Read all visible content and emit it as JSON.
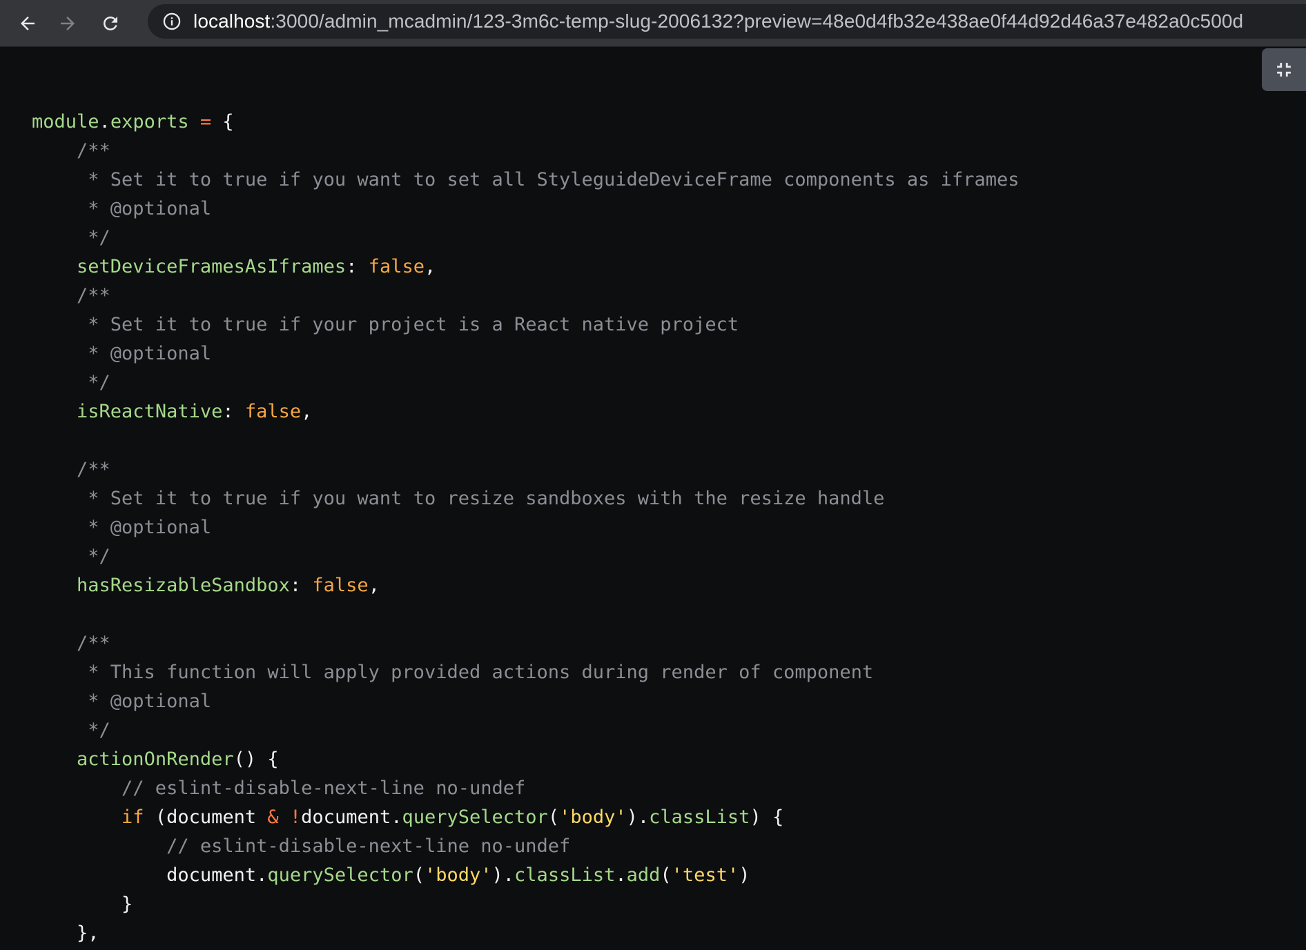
{
  "browser": {
    "url_host": "localhost",
    "url_rest": ":3000/admin_mcadmin/123-3m6c-temp-slug-2006132?preview=48e0d4fb32e438ae0f44d92d46a37e482a0c500d"
  },
  "code": {
    "l1": {
      "a": "module",
      "b": ".",
      "c": "exports",
      "d": " ",
      "e": "=",
      "f": " {"
    },
    "l2": "    /**",
    "l3": "     * Set it to true if you want to set all StyleguideDeviceFrame components as iframes",
    "l4": "     * @optional",
    "l5": "     */",
    "l6": {
      "indent": "    ",
      "key": "setDeviceFramesAsIframes",
      "colon": ": ",
      "val": "false",
      "end": ","
    },
    "l7": "    /**",
    "l8": "     * Set it to true if your project is a React native project",
    "l9": "     * @optional",
    "l10": "     */",
    "l11": {
      "indent": "    ",
      "key": "isReactNative",
      "colon": ": ",
      "val": "false",
      "end": ","
    },
    "l12": "",
    "l13": "    /**",
    "l14": "     * Set it to true if you want to resize sandboxes with the resize handle",
    "l15": "     * @optional",
    "l16": "     */",
    "l17": {
      "indent": "    ",
      "key": "hasResizableSandbox",
      "colon": ": ",
      "val": "false",
      "end": ","
    },
    "l18": "",
    "l19": "    /**",
    "l20": "     * This function will apply provided actions during render of component",
    "l21": "     * @optional",
    "l22": "     */",
    "l23": {
      "indent": "    ",
      "fn": "actionOnRender",
      "rest": "() {"
    },
    "l24": "        // eslint-disable-next-line no-undef",
    "l25": {
      "indent": "        ",
      "kw": "if",
      "p1": " (document ",
      "op1": "&",
      "sp": " ",
      "op2": "!",
      "p2": "document.",
      "m1": "querySelector",
      "p3": "(",
      "s1": "'body'",
      "p4": ").",
      "m2": "classList",
      "p5": ") {"
    },
    "l26": "            // eslint-disable-next-line no-undef",
    "l27": {
      "indent": "            ",
      "p1": "document.",
      "m1": "querySelector",
      "p2": "(",
      "s1": "'body'",
      "p3": ").",
      "m2": "classList",
      "p4": ".",
      "m3": "add",
      "p5": "(",
      "s2": "'test'",
      "p6": ")"
    },
    "l28": "        }",
    "l29": "    },"
  }
}
